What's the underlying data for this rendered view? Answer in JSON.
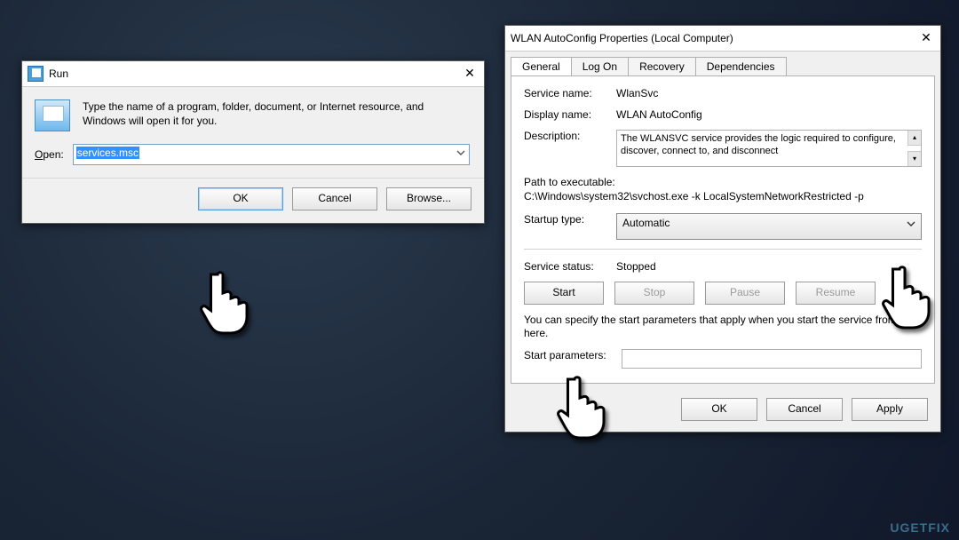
{
  "run": {
    "title": "Run",
    "description": "Type the name of a program, folder, document, or Internet resource, and Windows will open it for you.",
    "open_label": "Open:",
    "input_value": "services.msc",
    "ok_label": "OK",
    "cancel_label": "Cancel",
    "browse_label": "Browse..."
  },
  "prop": {
    "title": "WLAN AutoConfig Properties (Local Computer)",
    "tabs": [
      "General",
      "Log On",
      "Recovery",
      "Dependencies"
    ],
    "service_name_lbl": "Service name:",
    "service_name_val": "WlanSvc",
    "display_name_lbl": "Display name:",
    "display_name_val": "WLAN AutoConfig",
    "description_lbl": "Description:",
    "description_val": "The WLANSVC service provides the logic required to configure, discover, connect to, and disconnect",
    "path_lbl": "Path to executable:",
    "path_val": "C:\\Windows\\system32\\svchost.exe -k LocalSystemNetworkRestricted -p",
    "startup_lbl": "Startup type:",
    "startup_val": "Automatic",
    "status_lbl": "Service status:",
    "status_val": "Stopped",
    "start_btn": "Start",
    "stop_btn": "Stop",
    "pause_btn": "Pause",
    "resume_btn": "Resume",
    "hint": "You can specify the start parameters that apply when you start the service from here.",
    "params_lbl": "Start parameters:",
    "ok_label": "OK",
    "cancel_label": "Cancel",
    "apply_label": "Apply"
  },
  "watermark": "UGETFIX"
}
